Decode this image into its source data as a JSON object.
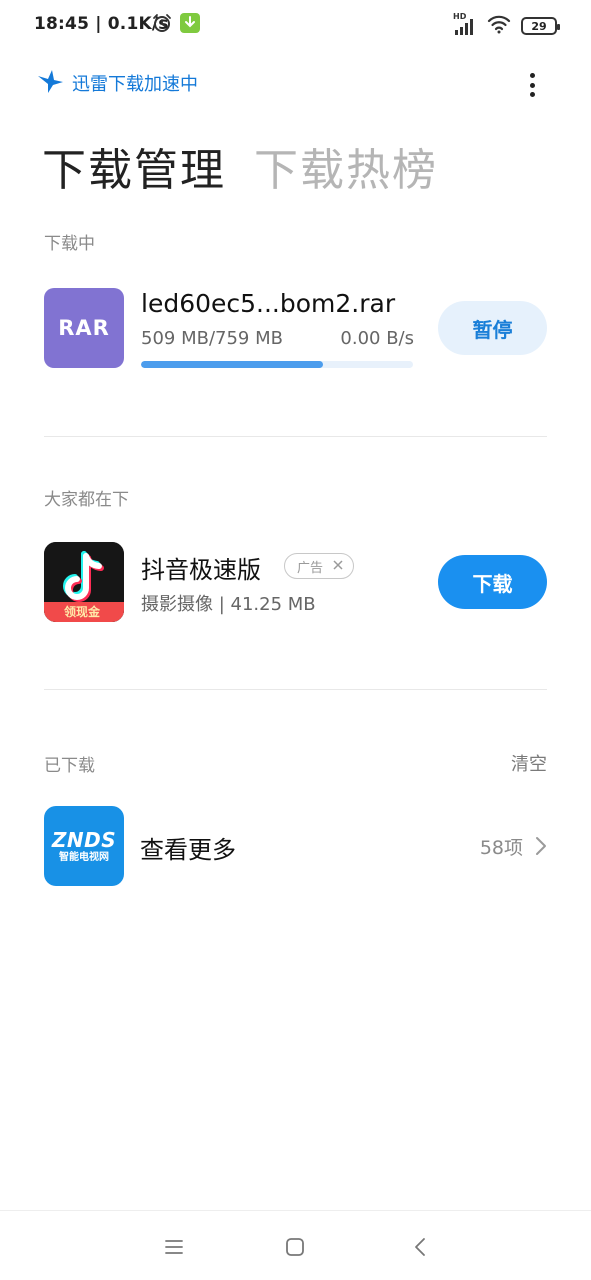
{
  "status_bar": {
    "time_speed": "18:45 | 0.1K/s",
    "battery": "29",
    "network_label": "HD",
    "icons": [
      "alarm-icon",
      "download-notification-icon",
      "signal-icon",
      "wifi-icon",
      "battery-icon"
    ]
  },
  "header": {
    "brand_text": "迅雷下载加速中",
    "brand_icon": "xunlei-bird-icon",
    "menu_icon": "more-vertical-icon"
  },
  "tabs": [
    {
      "label": "下载管理",
      "active": true
    },
    {
      "label": "下载热榜",
      "active": false
    }
  ],
  "downloading": {
    "section_title": "下载中",
    "file_type": "RAR",
    "file_name": "led60ec5...bom2.rar",
    "size": "509 MB/759 MB",
    "speed": "0.00 B/s",
    "progress": 0.6706,
    "button": "暂停"
  },
  "recommended": {
    "section_title": "大家都在下",
    "app_name": "抖音极速版",
    "ad_label": "广告",
    "meta": "摄影摄像 | 41.25 MB",
    "icon_banner": "领现金",
    "button": "下载"
  },
  "downloaded": {
    "section_title": "已下载",
    "clear": "清空",
    "icon_logo": "ZNDS",
    "icon_sub": "智能电视网",
    "view_more": "查看更多",
    "count": "58项"
  },
  "colors": {
    "accent": "#1a90f0",
    "brand_blue": "#1479d8",
    "rar_purple": "#8173d2",
    "progress": "#4c9ded"
  }
}
